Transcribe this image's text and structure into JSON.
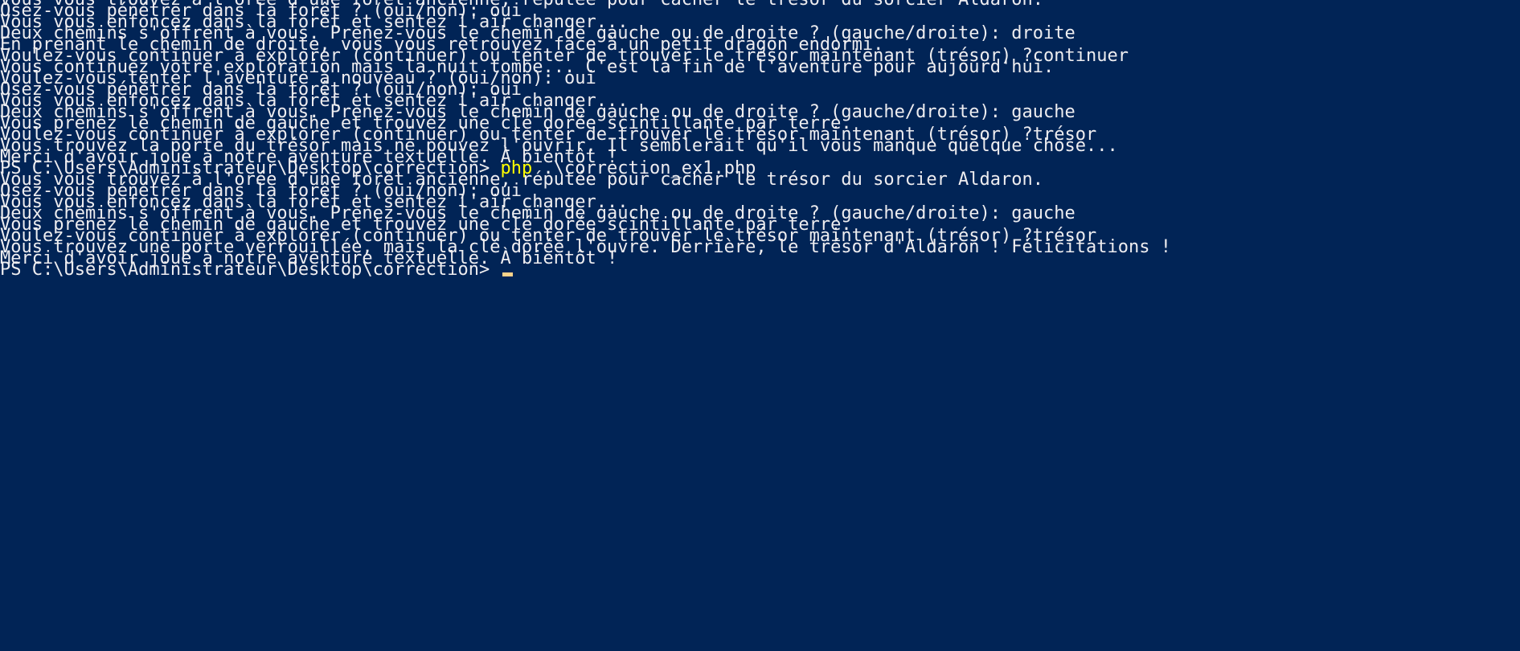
{
  "colors": {
    "background": "#012456",
    "text": "#eeedf0",
    "command": "#ffff00",
    "cursor": "#fed28a"
  },
  "output_block_1": [
    "Vous vous trouvez à l'orée d'une forêt ancienne, réputée pour cacher le trésor du sorcier Aldaron.",
    "Osez-vous pénétrer dans la forêt ? (oui/non): oui",
    "Vous vous enfoncez dans la forêt et sentez l'air changer...",
    "Deux chemins s'offrent à vous. Prenez-vous le chemin de gauche ou de droite ? (gauche/droite): droite",
    "En prenant le chemin de droite, vous vous retrouvez face à un petit dragon endormi.",
    "Voulez-vous continuer à explorer (continuer) ou tenter de trouver le trésor maintenant (trésor) ?continuer",
    "Vous continuez votre exploration mais la nuit tombe... C'est la fin de l'aventure pour aujourd'hui.",
    "Voulez-vous tenter l'aventure à nouveau ? (oui/non): oui",
    "Osez-vous pénétrer dans la forêt ? (oui/non): oui",
    "Vous vous enfoncez dans la forêt et sentez l'air changer...",
    "Deux chemins s'offrent à vous. Prenez-vous le chemin de gauche ou de droite ? (gauche/droite): gauche",
    "Vous prenez le chemin de gauche et trouvez une clé dorée scintillante par terre.",
    "Voulez-vous continuer à explorer (continuer) ou tenter de trouver le trésor maintenant (trésor) ?trésor",
    "Vous trouvez la porte du trésor mais ne pouvez l'ouvrir. Il semblerait qu'il vous manque quelque chose...",
    "Merci d'avoir joué à notre aventure textuelle. À bientôt !"
  ],
  "prompt_1": {
    "prompt": "PS C:\\Users\\Administrateur\\Desktop\\correction> ",
    "command": "php",
    "args": " .\\correction_ex1.php"
  },
  "output_block_2": [
    "Vous vous trouvez à l'orée d'une forêt ancienne, réputée pour cacher le trésor du sorcier Aldaron.",
    "Osez-vous pénétrer dans la forêt ? (oui/non): oui",
    "Vous vous enfoncez dans la forêt et sentez l'air changer...",
    "Deux chemins s'offrent à vous. Prenez-vous le chemin de gauche ou de droite ? (gauche/droite): gauche",
    "Vous prenez le chemin de gauche et trouvez une clé dorée scintillante par terre.",
    "Voulez-vous continuer à explorer (continuer) ou tenter de trouver le trésor maintenant (trésor) ?trésor",
    "Vous trouvez une porte verrouillée, mais la clé dorée l'ouvre. Derrière, le trésor d'Aldaron ! Félicitations !",
    "Merci d'avoir joué à notre aventure textuelle. À bientôt !"
  ],
  "prompt_2": {
    "prompt": "PS C:\\Users\\Administrateur\\Desktop\\correction> "
  }
}
